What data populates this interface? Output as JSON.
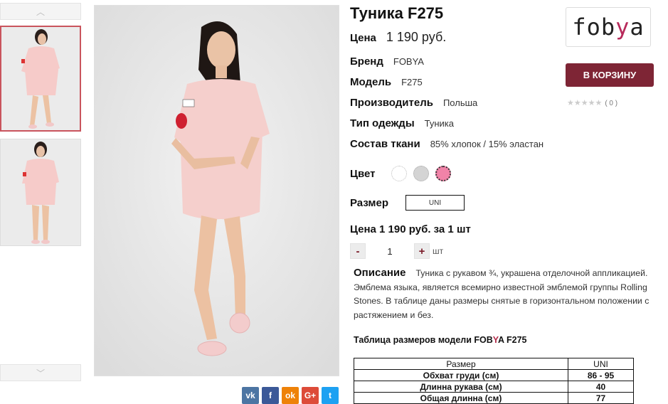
{
  "product": {
    "title": "Туника F275",
    "price_label": "Цена",
    "price": "1 190 руб.",
    "attributes": [
      {
        "label": "Бренд",
        "value": "FOBYA"
      },
      {
        "label": "Модель",
        "value": "F275"
      },
      {
        "label": "Производитель",
        "value": "Польша"
      },
      {
        "label": "Тип одежды",
        "value": "Туника"
      },
      {
        "label": "Состав ткани",
        "value": "85% хлопок / 15% эластан"
      }
    ],
    "color_label": "Цвет",
    "colors": [
      "#ffffff",
      "#d4d4d4",
      "#f183a8"
    ],
    "size_label": "Размер",
    "size_value": "UNI",
    "total_price": "Цена 1 190 руб. за 1 шт",
    "quantity": {
      "minus": "-",
      "value": "1",
      "plus": "+",
      "unit": "шт"
    }
  },
  "description": {
    "label": "Описание",
    "text": "Туника с рукавом ¾, украшена отделочной аппликацией. Эмблема языка, является всемирно известной эмблемой группы Rolling Stones. В таблице даны размеры снятые в горизонтальном положении с растяжением и без."
  },
  "size_table": {
    "title_prefix": "Таблица размеров модели FOB",
    "title_accent": "Y",
    "title_suffix": "A F275",
    "headers": [
      "Размер",
      "UNI"
    ],
    "rows": [
      [
        "Обхват груди (см)",
        "86 - 95"
      ],
      [
        "Длинна рукава (см)",
        "40"
      ],
      [
        "Общая длинна (см)",
        "77"
      ]
    ]
  },
  "sidebar": {
    "logo_prefix": "fob",
    "logo_accent": "y",
    "logo_suffix": "a",
    "cart_button": "В КОРЗИНУ",
    "rating_stars": "★★★★★",
    "rating_count": "( 0 )"
  },
  "share": [
    {
      "icon": "vk-icon",
      "glyph": "vk",
      "color": "#4c75a3"
    },
    {
      "icon": "facebook-icon",
      "glyph": "f",
      "color": "#3b5998"
    },
    {
      "icon": "odnoklassniki-icon",
      "glyph": "ok",
      "color": "#ee8208"
    },
    {
      "icon": "google-plus-icon",
      "glyph": "G+",
      "color": "#dd4b39"
    },
    {
      "icon": "twitter-icon",
      "glyph": "t",
      "color": "#1da1f2"
    }
  ],
  "gallery": {
    "up_arrow": "︿",
    "down_arrow": "﹀"
  }
}
